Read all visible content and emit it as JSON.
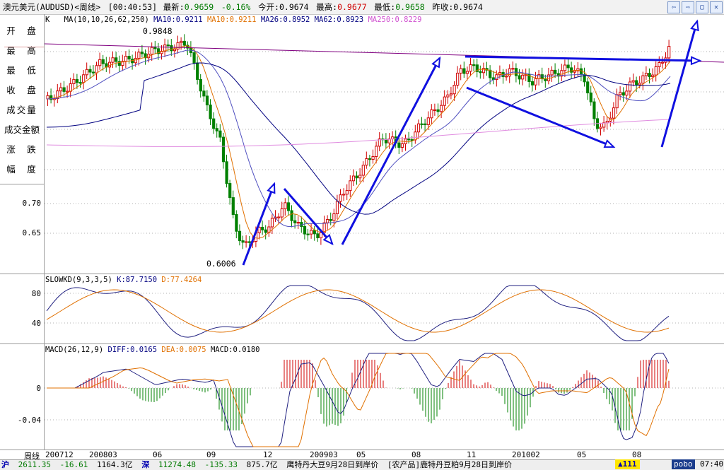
{
  "title_bar": {
    "symbol": "澳元美元(AUDUSD)<周线>",
    "time": "[00:40:53]",
    "latest_label": "最新:",
    "latest_value": "0.9659",
    "change": "-0.16%",
    "open_label": "今开:",
    "open_value": "0.9674",
    "high_label": "最高:",
    "high_value": "0.9677",
    "low_label": "最低:",
    "low_value": "0.9658",
    "prev_close_label": "昨收:",
    "prev_close_value": "0.9674"
  },
  "window_buttons": [
    "⇦",
    "⇨",
    "▢",
    "✕"
  ],
  "left_labels": [
    "开　盘",
    "最　高",
    "最　低",
    "收　盘",
    "成交量",
    "成交金额",
    "涨　跌",
    "幅　度"
  ],
  "price_panel": {
    "header_k": "K",
    "header_ma": "MA(10,10,26,62,250)",
    "ma_values": [
      {
        "label": "MA10:0.9211",
        "color": "#000080"
      },
      {
        "label": "MA10:0.9211",
        "color": "#e07000"
      },
      {
        "label": "MA26:0.8952",
        "color": "#000080"
      },
      {
        "label": "MA62:0.8923",
        "color": "#000080"
      },
      {
        "label": "MA250:0.8229",
        "color": "#d050d0"
      }
    ],
    "yticks": [
      "0.70",
      "0.65"
    ],
    "high_annotation": "0.9848",
    "low_annotation": "0.6006"
  },
  "kd_panel": {
    "title": "SLOWKD(9,3,3,5)",
    "k": "K:87.7150",
    "d": "D:77.4264",
    "yticks": [
      "80",
      "40"
    ]
  },
  "macd_panel": {
    "title": "MACD(26,12,9)",
    "diff": "DIFF:0.0165",
    "dea": "DEA:0.0075",
    "macd": "MACD:0.0180",
    "yticks": [
      "0",
      "-0.04"
    ]
  },
  "x_axis": {
    "period_label": "周线",
    "labels": [
      "200712",
      "200803",
      "06",
      "09",
      "12",
      "200903",
      "05",
      "08",
      "11",
      "201002",
      "05",
      "08"
    ]
  },
  "status_bar": {
    "sh_label": "沪",
    "sh_index": "2611.35",
    "sh_change": "-16.61",
    "sh_amount": "1164.3亿",
    "sz_label": "深",
    "sz_index": "11274.48",
    "sz_change": "-135.33",
    "sz_amount": "875.7亿",
    "news1": "鹰特丹大豆9月28日到岸价",
    "news2": "[农产品]鹿特丹豆粕9月28日到岸价",
    "alert": "▲111",
    "brand": "pobo",
    "clock": "07:40"
  },
  "colors": {
    "up": "#d00000",
    "down": "#008000",
    "ma_blue": "#000080",
    "ma_orange": "#e07000",
    "ma_pink": "#e08ce0",
    "ma_purple": "#800080",
    "arrow": "#1010e0"
  }
}
